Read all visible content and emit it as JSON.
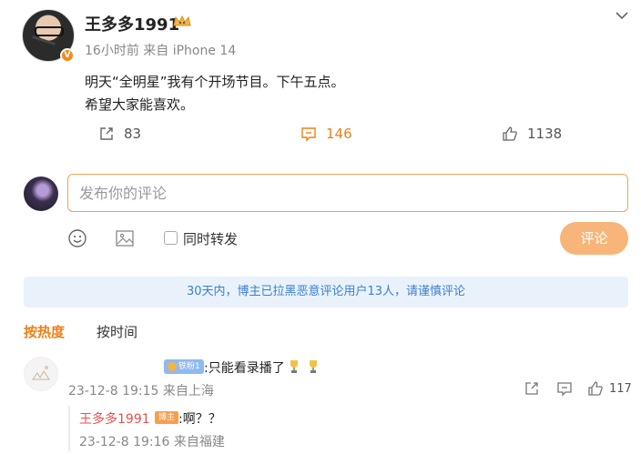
{
  "post": {
    "username": "王多多1991",
    "meta": "16小时前 来自 iPhone 14",
    "verified_badge": "V",
    "lines": [
      "明天“全明星”我有个开场节目。下午五点。",
      "希望大家能喜欢。"
    ],
    "reposts": "83",
    "comments": "146",
    "likes": "1138"
  },
  "composer": {
    "placeholder": "发布你的评论",
    "forward_label": "同时转发",
    "submit_label": "评论"
  },
  "notice": "30天内，博主已拉黑恶意评论用户13人，请谨慎评论",
  "sort_tabs": [
    {
      "label": "按热度",
      "active": true
    },
    {
      "label": "按时间",
      "active": false
    }
  ],
  "comment": {
    "fan_badge": "铁粉1",
    "text": ":只能看录播了",
    "meta": "23-12-8 19:15 来自上海",
    "likes": "117",
    "reply": {
      "user": "王多多1991",
      "badge": "博主",
      "text": ":啊？？",
      "meta": "23-12-8 19:16 来自福建"
    }
  },
  "colors": {
    "accent": "#f07f1a",
    "notice_bg": "#e9f2fb",
    "notice_text": "#3b7fd1",
    "reply_user": "#e5524a"
  }
}
